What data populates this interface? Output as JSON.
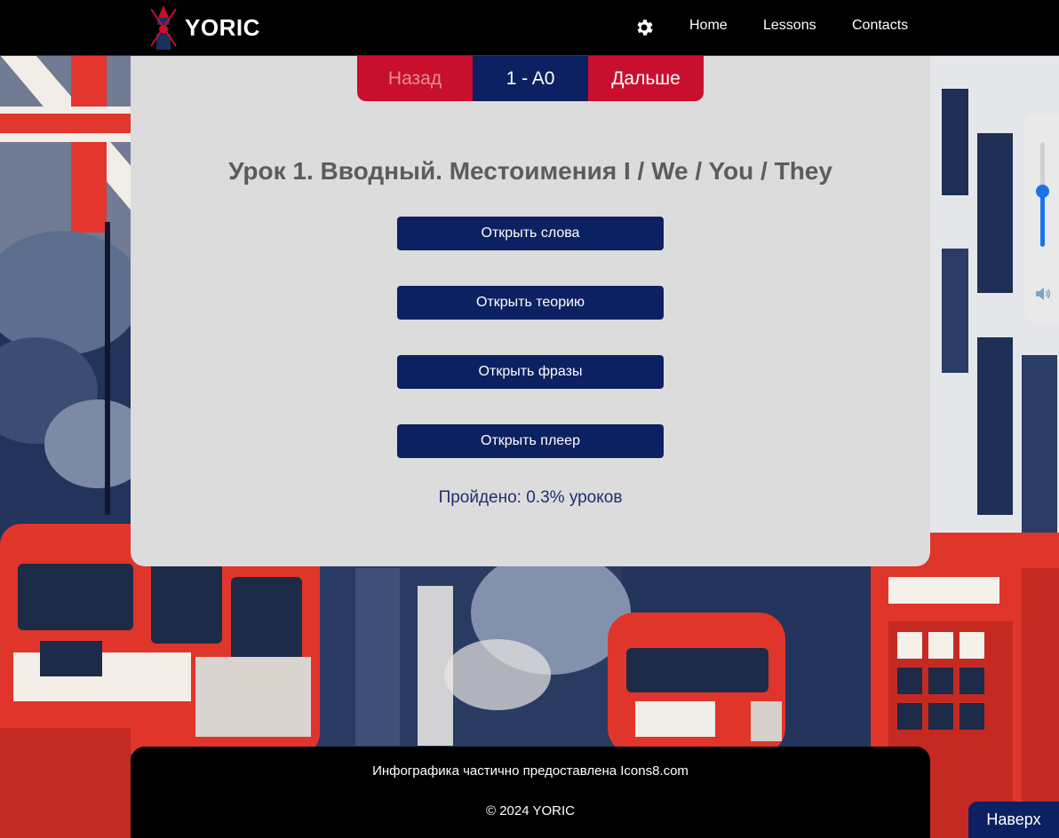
{
  "header": {
    "brand": "YORIC",
    "logo_icon": "big-ben-icon",
    "settings_icon": "gear-icon",
    "nav": [
      {
        "label": "Home"
      },
      {
        "label": "Lessons"
      },
      {
        "label": "Contacts"
      }
    ]
  },
  "pager": {
    "prev_label": "Назад",
    "current_label": "1 - A0",
    "next_label": "Дальше"
  },
  "lesson": {
    "title": "Урок 1. Вводный. Местоимения I / We / You / They",
    "buttons": [
      {
        "label": "Открыть слова"
      },
      {
        "label": "Открыть теорию"
      },
      {
        "label": "Открыть фразы"
      },
      {
        "label": "Открыть плеер"
      }
    ],
    "progress_text": "Пройдено: 0.3% уроков"
  },
  "volume": {
    "level": 0.53,
    "icon": "speaker-icon"
  },
  "footer": {
    "credit": "Инфографика частично предоставлена Icons8.com",
    "copyright": "© 2024 YORIC"
  },
  "to_top_label": "Наверх",
  "colors": {
    "accent_navy": "#0c2161",
    "accent_red": "#c8102e",
    "card_bg": "#dcdcdc",
    "slider_blue": "#1a73e8"
  }
}
